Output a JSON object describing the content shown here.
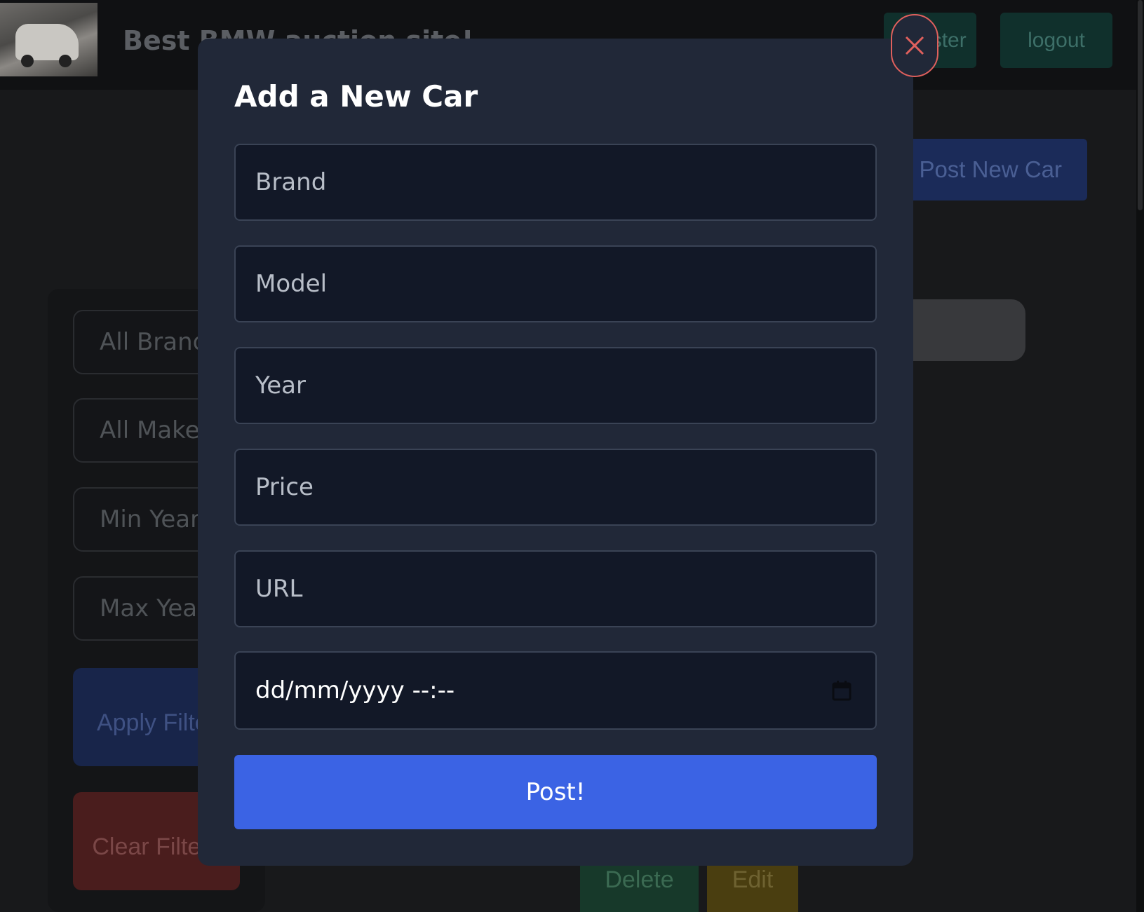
{
  "header": {
    "site_title": "Best BMW auction site!",
    "register_label": "Register",
    "logout_label": "logout"
  },
  "actions": {
    "post_new_car_label": "Post New Car"
  },
  "filters": {
    "brand_placeholder": "All Brands",
    "make_placeholder": "All Makes",
    "min_year_placeholder": "Min Year",
    "max_year_placeholder": "Max Year",
    "apply_label": "Apply Filter",
    "clear_label": "Clear Filters"
  },
  "card": {
    "delete_label": "Delete",
    "edit_label": "Edit"
  },
  "modal": {
    "title": "Add a New Car",
    "brand_placeholder": "Brand",
    "model_placeholder": "Model",
    "year_placeholder": "Year",
    "price_placeholder": "Price",
    "url_placeholder": "URL",
    "datetime_value": "dd/mm/yyyy  --:--",
    "post_label": "Post!",
    "close_icon": "close-icon",
    "calendar_icon": "calendar-icon"
  },
  "colors": {
    "accent_blue": "#3b63e4",
    "modal_bg": "#212838",
    "field_bg": "#121827",
    "close_red": "#e0605d"
  }
}
